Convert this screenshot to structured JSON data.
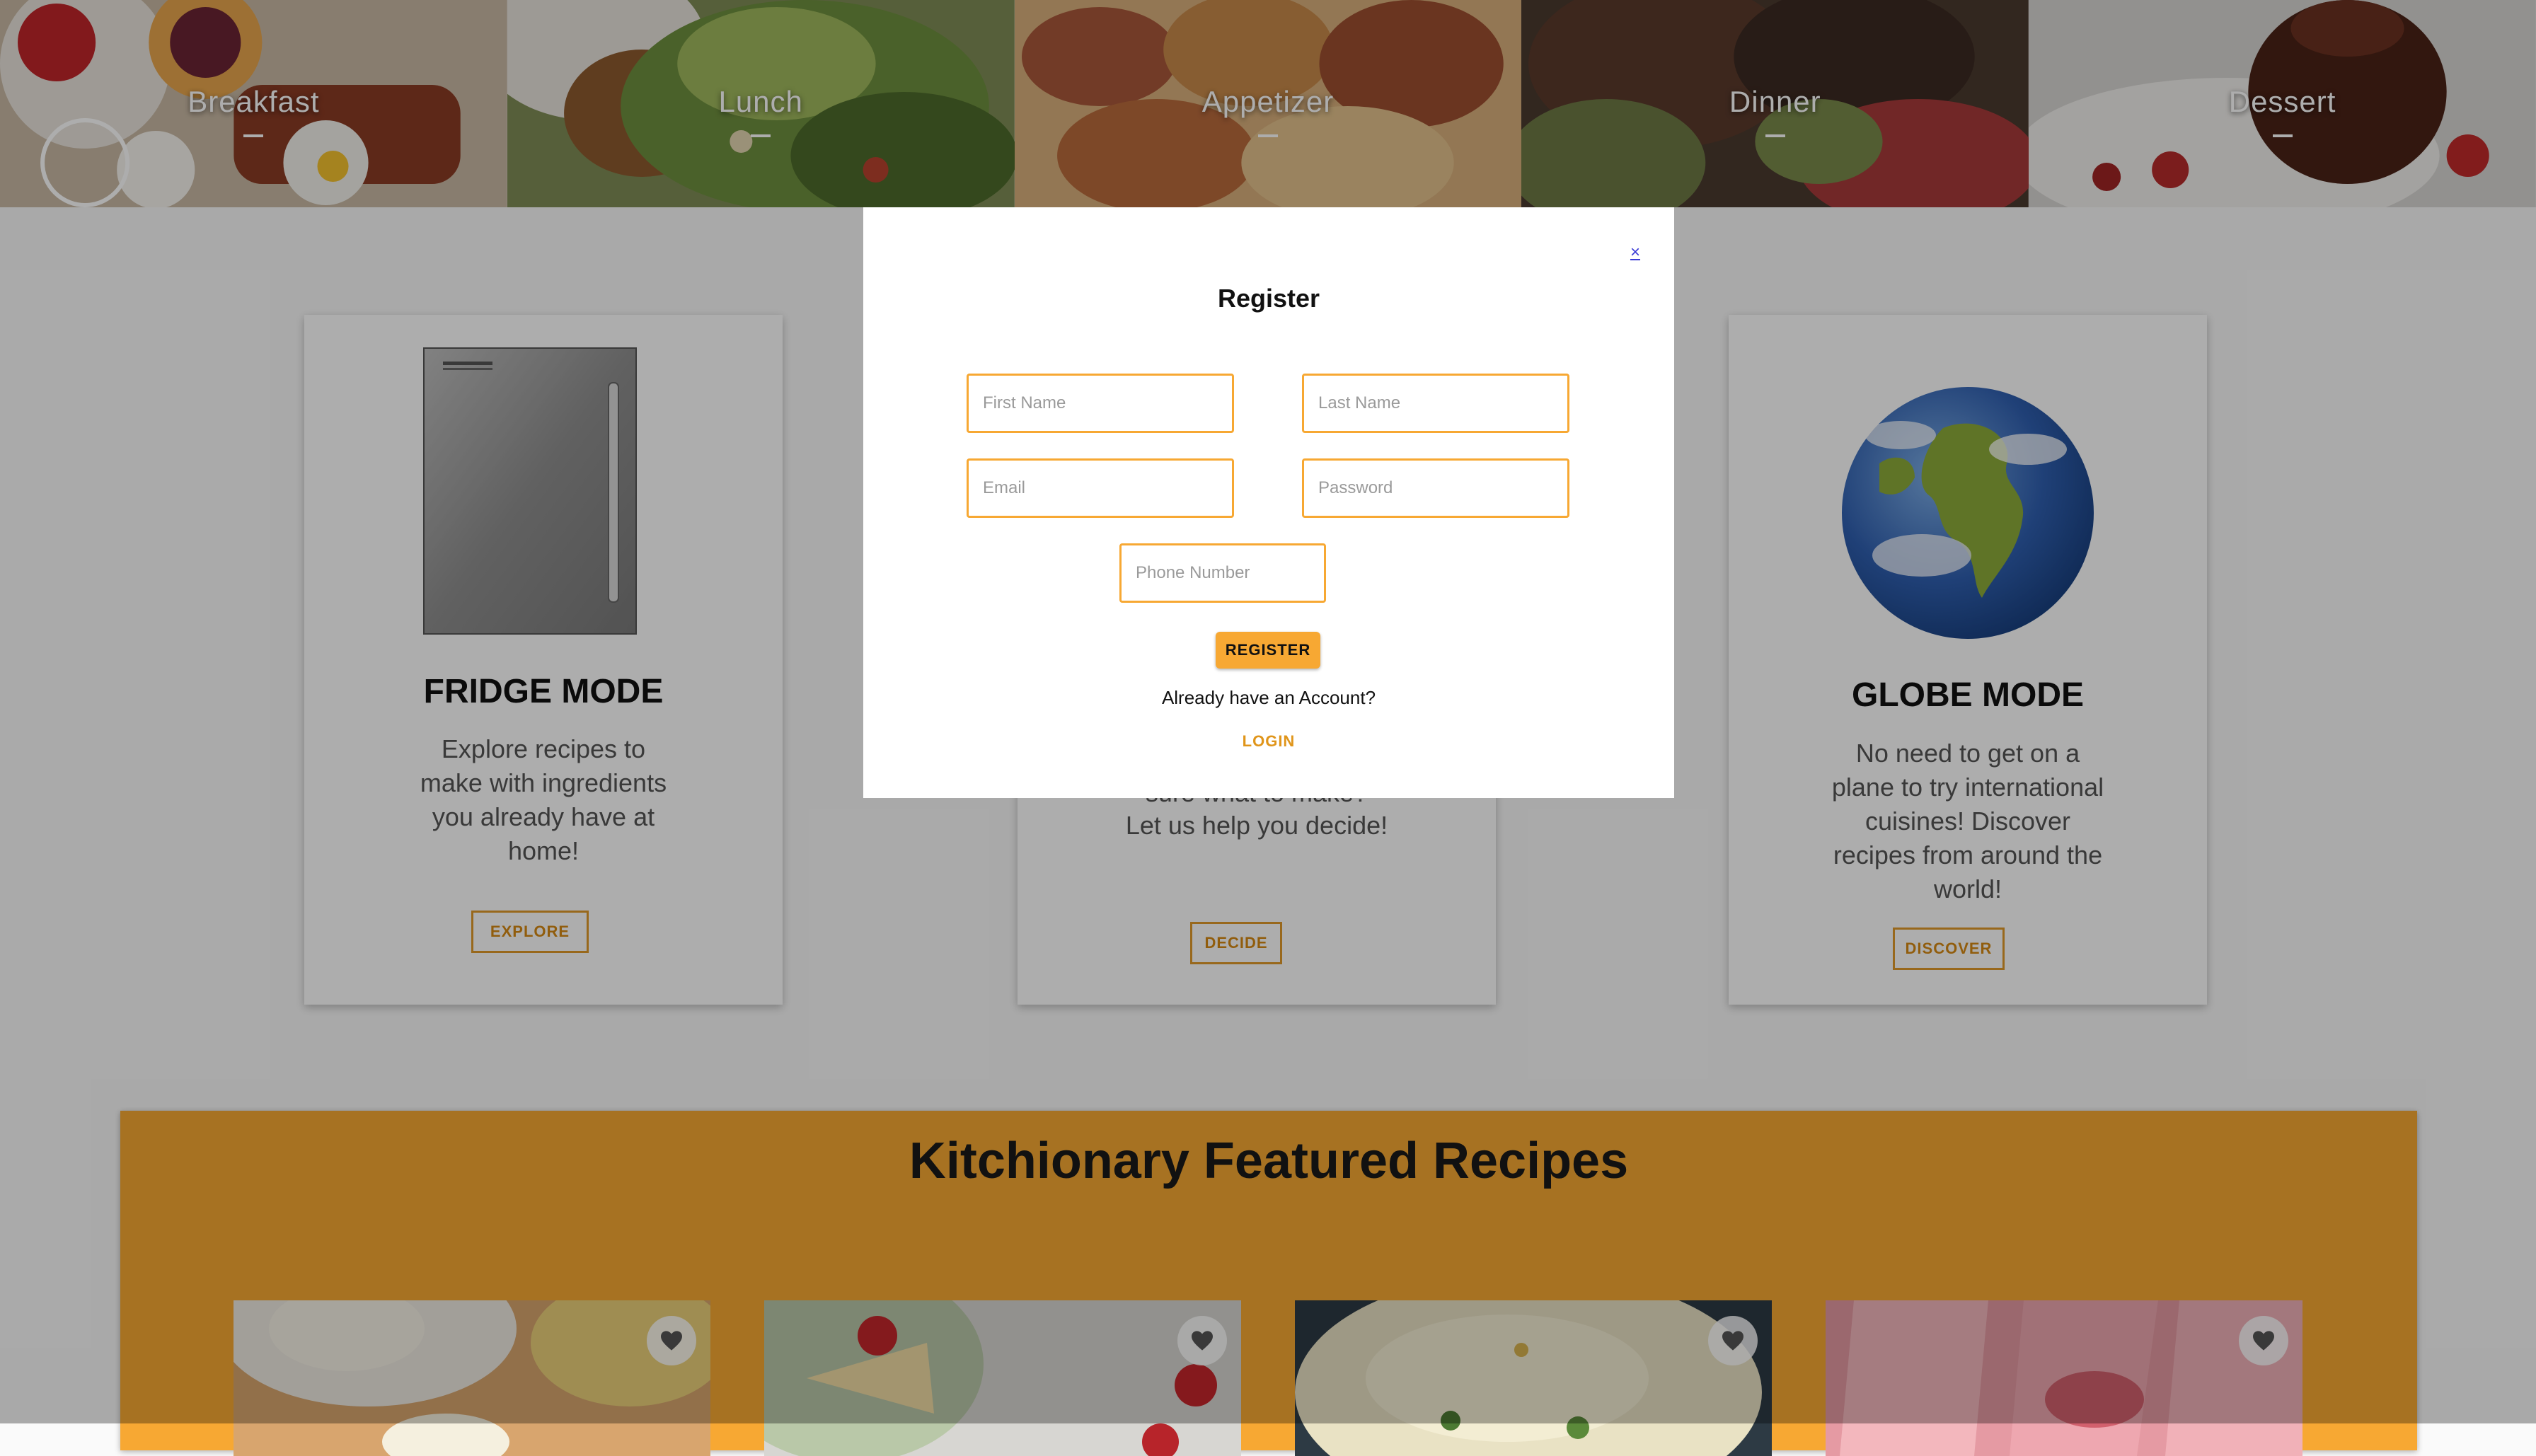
{
  "categories": [
    {
      "label": "Breakfast",
      "icon": "breakfast-photo"
    },
    {
      "label": "Lunch",
      "icon": "salad-photo"
    },
    {
      "label": "Appetizer",
      "icon": "appetizer-photo"
    },
    {
      "label": "Dinner",
      "icon": "steak-photo"
    },
    {
      "label": "Dessert",
      "icon": "lava-cake-photo"
    }
  ],
  "modes": {
    "fridge": {
      "title": "FRIDGE MODE",
      "description": "Explore recipes to make with ingredients you already have at home!",
      "button": "EXPLORE"
    },
    "decide": {
      "description_partial": "sure what to make?",
      "description_line2": "Let us help you decide!",
      "button": "DECIDE"
    },
    "globe": {
      "title": "GLOBE MODE",
      "description": "No need to get on a plane to try international cuisines! Discover recipes from around the world!",
      "button": "DISCOVER"
    }
  },
  "featured": {
    "title": "Kitchionary Featured Recipes",
    "cards": [
      {
        "image": "ice-cream-photo"
      },
      {
        "image": "strawberry-cake-photo"
      },
      {
        "image": "rice-dish-photo"
      },
      {
        "image": "strawberry-popsicle-photo"
      }
    ]
  },
  "register_modal": {
    "close": "×",
    "title": "Register",
    "first_name_placeholder": "First Name",
    "last_name_placeholder": "Last Name",
    "email_placeholder": "Email",
    "password_placeholder": "Password",
    "phone_placeholder": "Phone Number",
    "register_button": "REGISTER",
    "already_text": "Already have an Account?",
    "login_link": "LOGIN"
  },
  "colors": {
    "accent": "#f7a833",
    "accent_text": "#d68a14",
    "close_link": "#3b3bd6"
  }
}
